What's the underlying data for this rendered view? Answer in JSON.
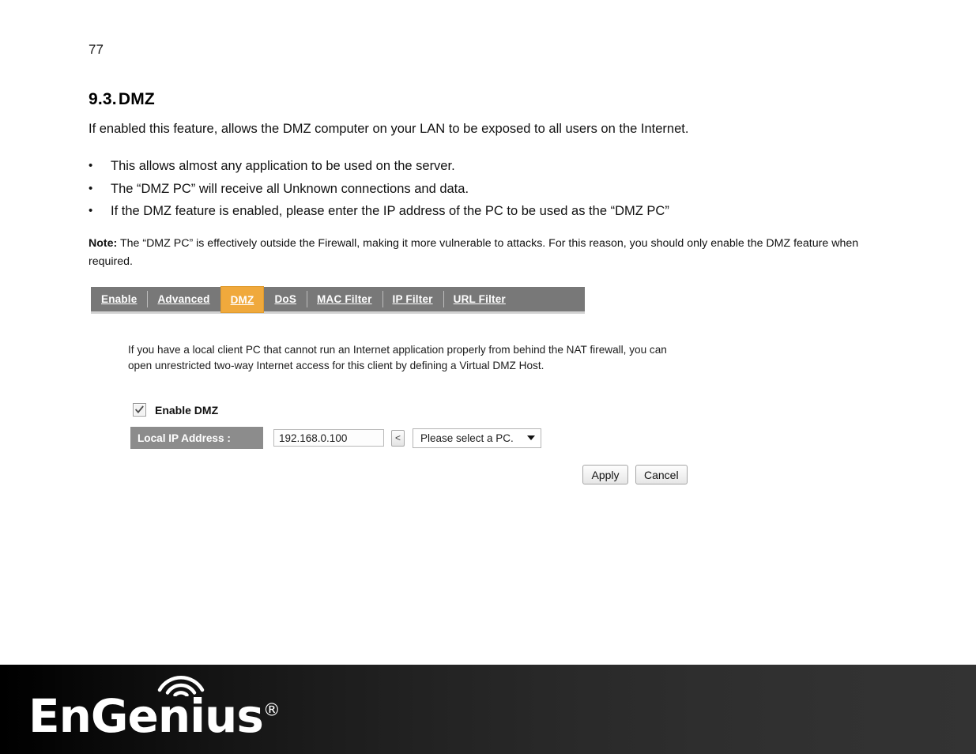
{
  "document": {
    "page_number": "77",
    "heading_number": "9.3.",
    "heading_title": "DMZ",
    "intro": "If enabled this feature, allows the DMZ computer on your LAN to be exposed to all users on the Internet.",
    "bullets": [
      "This allows almost any application to be used on the server.",
      "The “DMZ PC” will receive all Unknown connections and data.",
      "If the DMZ feature is enabled, please enter the IP address of the PC to be used as the “DMZ PC”"
    ],
    "bullet_marker": "•",
    "note_label": "Note:",
    "note_text": " The “DMZ PC” is effectively outside the Firewall, making it more vulnerable to attacks. For this reason, you should only enable the DMZ feature when required."
  },
  "router_ui": {
    "tabs": [
      {
        "label": "Enable",
        "active": false
      },
      {
        "label": "Advanced",
        "active": false
      },
      {
        "label": "DMZ",
        "active": true
      },
      {
        "label": "DoS",
        "active": false
      },
      {
        "label": "MAC Filter",
        "active": false
      },
      {
        "label": "IP Filter",
        "active": false
      },
      {
        "label": "URL Filter",
        "active": false
      }
    ],
    "description": "If you have a local client PC that cannot run an Internet application properly from behind the NAT firewall, you can open unrestricted two-way Internet access for this client by defining a Virtual DMZ Host.",
    "enable_dmz_label": "Enable DMZ",
    "enable_dmz_checked": true,
    "local_ip_label": "Local IP Address :",
    "local_ip_value": "192.168.0.100",
    "local_ip_placeholder": "192.168.0.100",
    "copy_button_label": "<",
    "pc_select_value": "Please select a PC.",
    "apply_label": "Apply",
    "cancel_label": "Cancel",
    "colors": {
      "tab_bar": "#787878",
      "active_tab": "#f0a93c",
      "field_label": "#8c8c8c"
    }
  },
  "footer": {
    "brand": "EnGenius",
    "registered_mark": "®"
  }
}
